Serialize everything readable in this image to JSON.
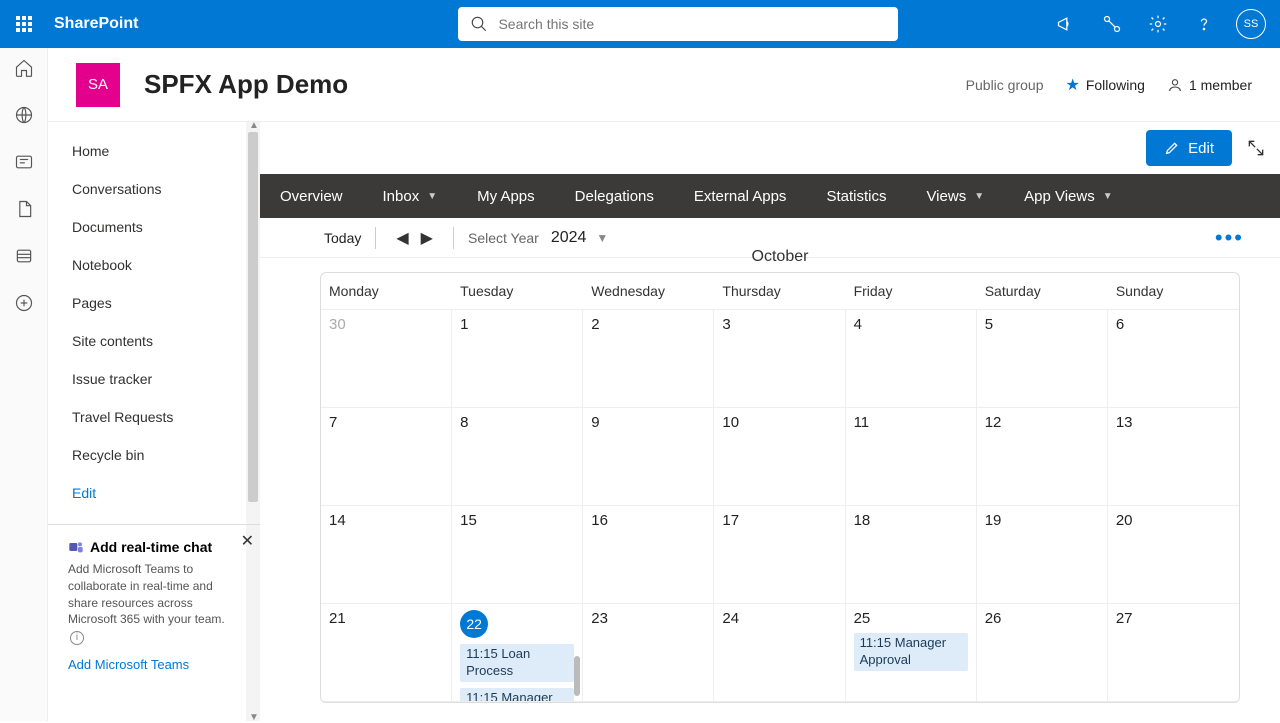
{
  "brand": "SharePoint",
  "search": {
    "placeholder": "Search this site"
  },
  "user": {
    "initials": "SS"
  },
  "site": {
    "logo_initials": "SA",
    "title": "SPFX App Demo",
    "visibility": "Public group",
    "following": "Following",
    "members": "1 member"
  },
  "nav": {
    "items": [
      "Home",
      "Conversations",
      "Documents",
      "Notebook",
      "Pages",
      "Site contents",
      "Issue tracker",
      "Travel Requests",
      "Recycle bin"
    ],
    "edit": "Edit"
  },
  "chat_card": {
    "title": "Add real-time chat",
    "desc": "Add Microsoft Teams to collaborate in real-time and share resources across Microsoft 365 with your team.",
    "link": "Add Microsoft Teams"
  },
  "edit_button": "Edit",
  "tabs": [
    "Overview",
    "Inbox",
    "My Apps",
    "Delegations",
    "External Apps",
    "Statistics",
    "Views",
    "App Views"
  ],
  "tabs_with_caret": [
    false,
    true,
    false,
    false,
    false,
    false,
    true,
    true
  ],
  "toolbar": {
    "today": "Today",
    "select_year": "Select Year",
    "year": "2024"
  },
  "month": "October",
  "day_headers": [
    "Monday",
    "Tuesday",
    "Wednesday",
    "Thursday",
    "Friday",
    "Saturday",
    "Sunday"
  ],
  "rows": [
    [
      {
        "n": "30",
        "prev": true
      },
      {
        "n": "1"
      },
      {
        "n": "2"
      },
      {
        "n": "3"
      },
      {
        "n": "4"
      },
      {
        "n": "5"
      },
      {
        "n": "6"
      }
    ],
    [
      {
        "n": "7"
      },
      {
        "n": "8"
      },
      {
        "n": "9"
      },
      {
        "n": "10"
      },
      {
        "n": "11"
      },
      {
        "n": "12"
      },
      {
        "n": "13"
      }
    ],
    [
      {
        "n": "14"
      },
      {
        "n": "15"
      },
      {
        "n": "16"
      },
      {
        "n": "17"
      },
      {
        "n": "18"
      },
      {
        "n": "19"
      },
      {
        "n": "20"
      }
    ],
    [
      {
        "n": "21"
      },
      {
        "n": "22",
        "today": true,
        "events": [
          "11:15 Loan Process",
          "11:15 Manager"
        ],
        "scroll": true
      },
      {
        "n": "23"
      },
      {
        "n": "24"
      },
      {
        "n": "25",
        "events": [
          "11:15 Manager Approval"
        ]
      },
      {
        "n": "26"
      },
      {
        "n": "27"
      }
    ]
  ]
}
